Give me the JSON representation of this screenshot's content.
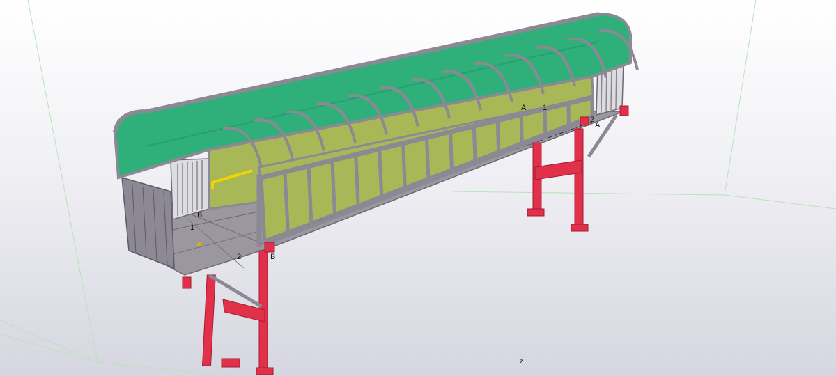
{
  "viewport": {
    "axis_label": "z"
  },
  "grid_labels": [
    {
      "id": "A-right",
      "text": "A"
    },
    {
      "id": "1-right",
      "text": "1"
    },
    {
      "id": "2-right",
      "text": "2"
    },
    {
      "id": "A-right-end",
      "text": "A"
    },
    {
      "id": "B-left",
      "text": "B"
    },
    {
      "id": "1-left",
      "text": "1"
    },
    {
      "id": "2-left",
      "text": "2"
    },
    {
      "id": "B-left-end",
      "text": "B"
    }
  ],
  "colors": {
    "roof_panel": "#2fb07a",
    "roof_panel_dark": "#1f8e61",
    "wall_panel": "#a9b856",
    "frame": "#8c8894",
    "frame_dark": "#6e6a75",
    "support": "#e0304a",
    "support_dark": "#a51d31",
    "floor": "#9a979f",
    "handrail": "#f2d400",
    "grating": "#dcdce2",
    "bounding_box": "#b9e3b9"
  }
}
